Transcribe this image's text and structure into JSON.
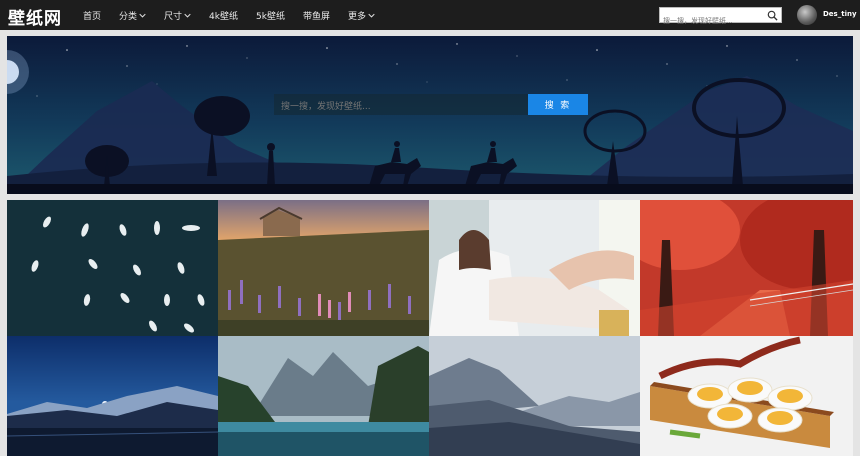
{
  "header": {
    "logo": "壁纸网",
    "nav": [
      {
        "label": "首页",
        "has_dropdown": false
      },
      {
        "label": "分类",
        "has_dropdown": true
      },
      {
        "label": "尺寸",
        "has_dropdown": true
      },
      {
        "label": "4k壁纸",
        "has_dropdown": false
      },
      {
        "label": "5k壁纸",
        "has_dropdown": false
      },
      {
        "label": "带鱼屏",
        "has_dropdown": false
      },
      {
        "label": "更多",
        "has_dropdown": true
      }
    ],
    "search": {
      "placeholder": "搜一搜，发现好壁纸...",
      "icon": "search-icon"
    },
    "user": {
      "name": "Des_tiny",
      "icon": "avatar"
    }
  },
  "banner": {
    "search": {
      "placeholder": "搜一搜，发现好壁纸...",
      "button_label": "搜 索"
    }
  },
  "colors": {
    "topbar": "#1d1d1d",
    "accent": "#1a86e6",
    "page_bg": "#e4e4e4"
  },
  "wallpapers": [
    {
      "subject": "boats-from-above"
    },
    {
      "subject": "lupine-field-church"
    },
    {
      "subject": "woman-in-bed"
    },
    {
      "subject": "red-autumn-trees"
    },
    {
      "subject": "night-mountain-lake"
    },
    {
      "subject": "alpine-lake"
    },
    {
      "subject": "misty-mountains"
    },
    {
      "subject": "bacon-egg-toast"
    }
  ]
}
